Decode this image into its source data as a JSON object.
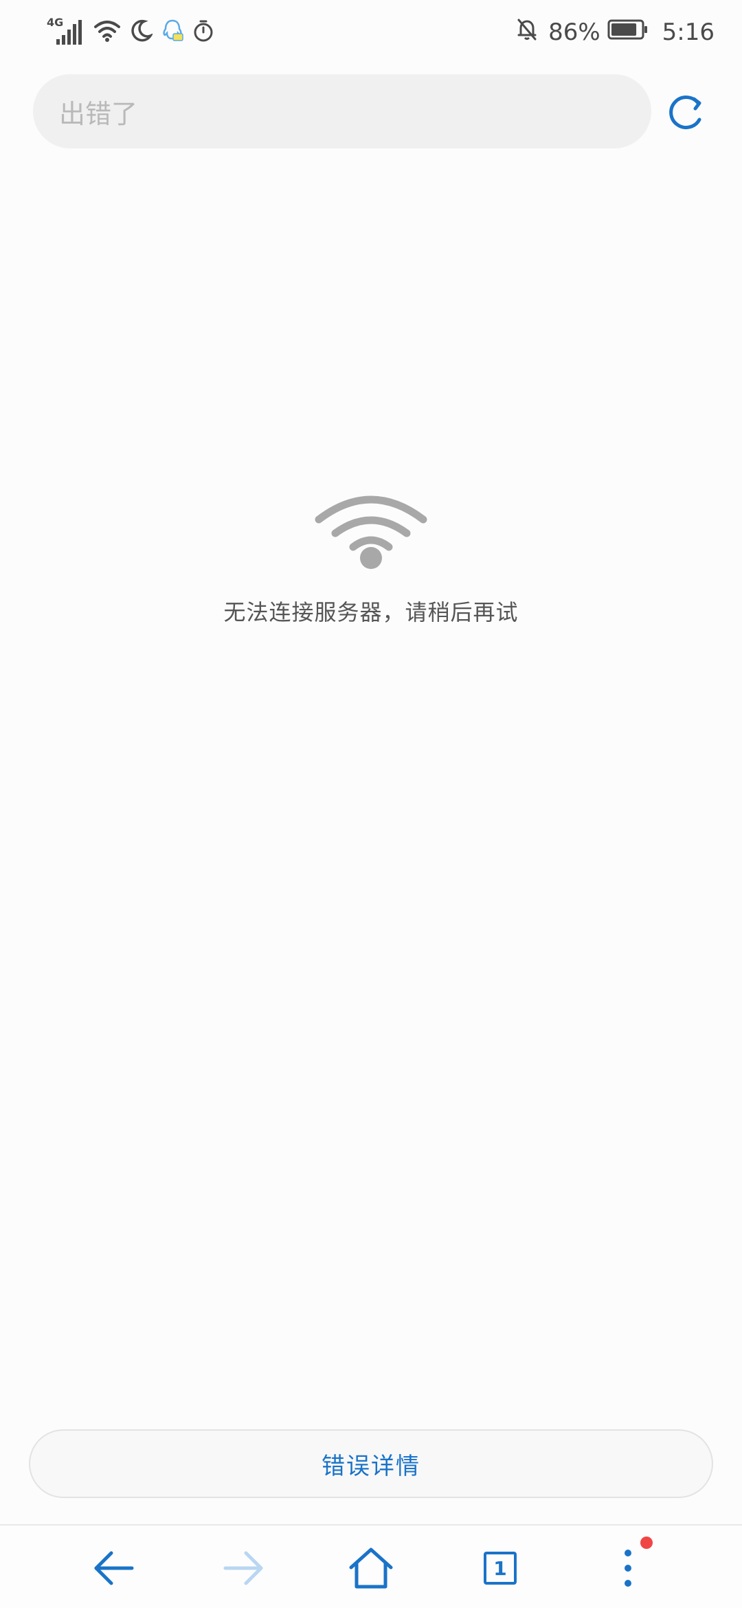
{
  "status_bar": {
    "network_label": "4G",
    "battery_percent": "86%",
    "time": "5:16",
    "battery_level": 0.86
  },
  "address_bar": {
    "text": "出错了"
  },
  "error": {
    "message": "无法连接服务器，请稍后再试"
  },
  "details_button": {
    "label": "错误详情"
  },
  "bottom_nav": {
    "tab_count": "1"
  },
  "colors": {
    "accent": "#1a73c8",
    "accent_disabled": "#b9d6f2",
    "icon_gray": "#a8a8a8",
    "badge_red": "#f04545"
  }
}
